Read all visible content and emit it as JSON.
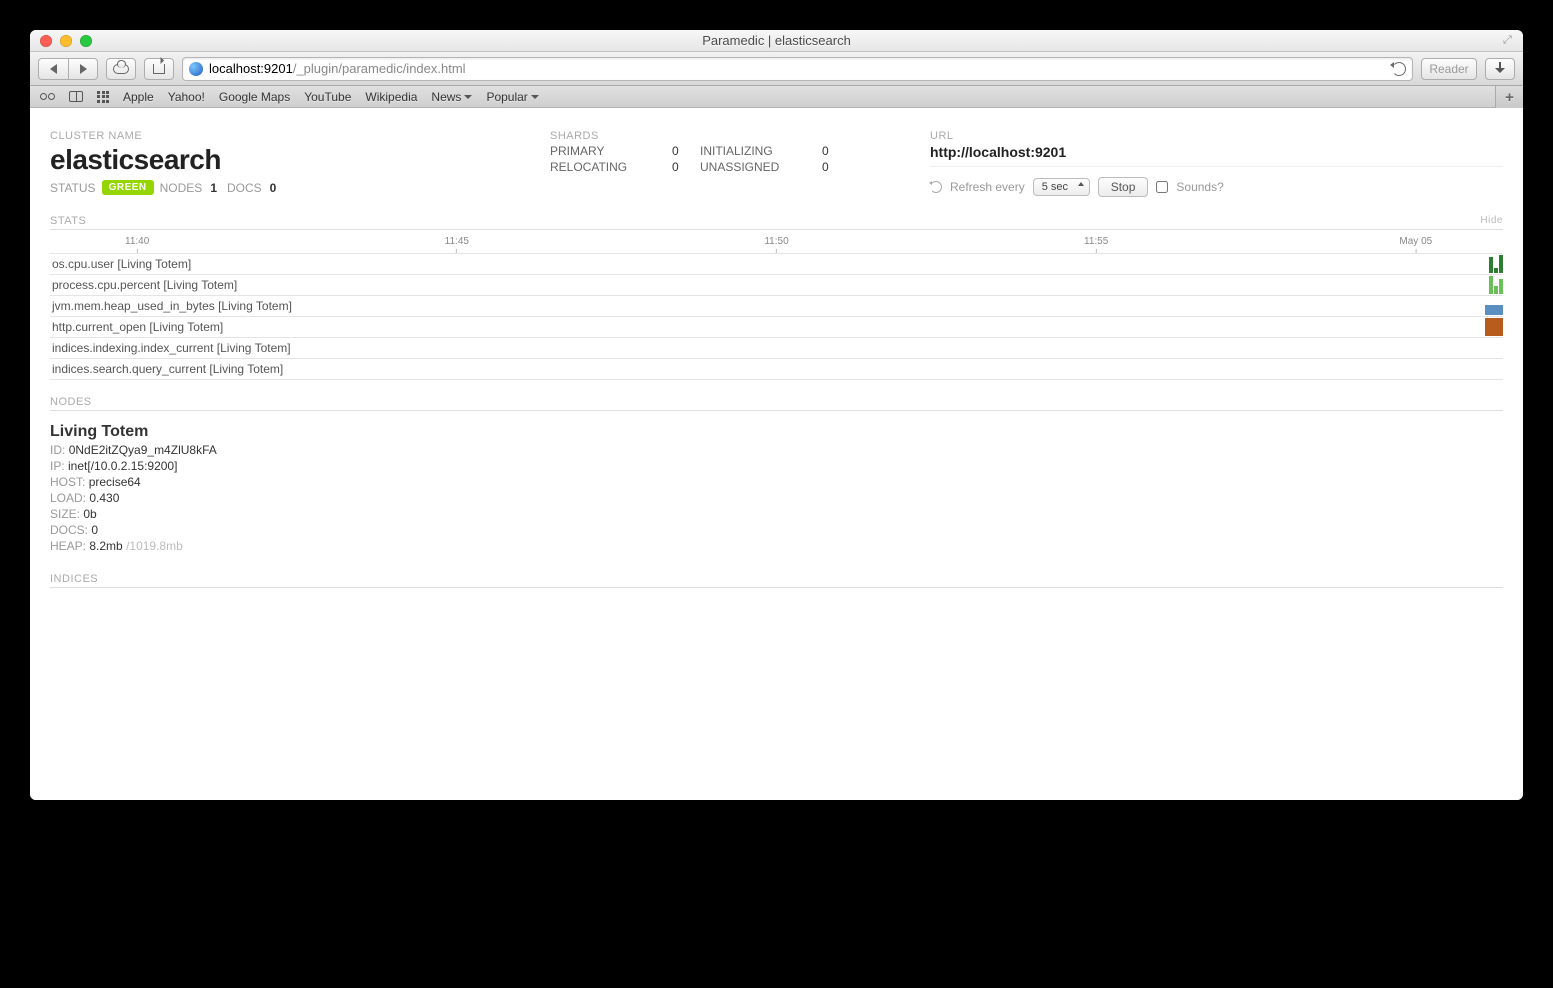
{
  "window": {
    "title": "Paramedic | elasticsearch"
  },
  "urlbar": {
    "strong": "localhost:9201",
    "weak": "/_plugin/paramedic/index.html"
  },
  "reader_label": "Reader",
  "bookmarks": [
    "Apple",
    "Yahoo!",
    "Google Maps",
    "YouTube",
    "Wikipedia",
    "News",
    "Popular"
  ],
  "cluster": {
    "label": "CLUSTER NAME",
    "name": "elasticsearch",
    "status_label": "STATUS",
    "status_value": "GREEN",
    "nodes_label": "NODES",
    "nodes_value": "1",
    "docs_label": "DOCS",
    "docs_value": "0"
  },
  "shards": {
    "label": "SHARDS",
    "primary_label": "PRIMARY",
    "primary_value": "0",
    "relocating_label": "RELOCATING",
    "relocating_value": "0",
    "initializing_label": "INITIALIZING",
    "initializing_value": "0",
    "unassigned_label": "UNASSIGNED",
    "unassigned_value": "0"
  },
  "url_section": {
    "label": "URL",
    "value": "http://localhost:9201",
    "refresh_label": "Refresh every",
    "interval": "5 sec",
    "stop_label": "Stop",
    "sounds_label": "Sounds?"
  },
  "stats": {
    "label": "STATS",
    "hide_label": "Hide",
    "ticks": [
      "11:40",
      "11:45",
      "11:50",
      "11:55",
      "May 05"
    ],
    "metrics": [
      "os.cpu.user [Living Totem]",
      "process.cpu.percent [Living Totem]",
      "jvm.mem.heap_used_in_bytes [Living Totem]",
      "http.current_open [Living Totem]",
      "indices.indexing.index_current [Living Totem]",
      "indices.search.query_current [Living Totem]"
    ]
  },
  "nodes": {
    "label": "NODES",
    "node": {
      "name": "Living Totem",
      "id_label": "ID:",
      "id": "0NdE2itZQya9_m4ZlU8kFA",
      "ip_label": "IP:",
      "ip": "inet[/10.0.2.15:9200]",
      "host_label": "HOST:",
      "host": "precise64",
      "load_label": "LOAD:",
      "load": "0.430",
      "size_label": "SIZE:",
      "size": "0b",
      "docs_label": "DOCS:",
      "docs": "0",
      "heap_label": "HEAP:",
      "heap": "8.2mb",
      "heap_total": "/1019.8mb"
    }
  },
  "indices": {
    "label": "INDICES"
  }
}
